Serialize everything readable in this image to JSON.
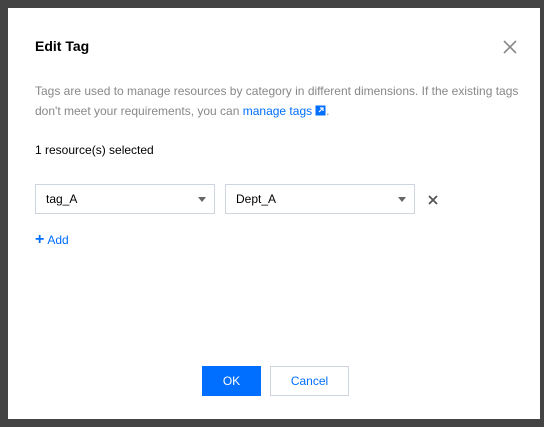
{
  "dialog": {
    "title": "Edit Tag",
    "description_text": "Tags are used to manage resources by category in different dimensions. If the existing tags don't meet your requirements, you can ",
    "manage_tags_link": "manage tags",
    "description_end": ".",
    "selected_count": "1 resource(s) selected",
    "tag_rows": [
      {
        "key": "tag_A",
        "value": "Dept_A"
      }
    ],
    "add_label": "Add",
    "ok_label": "OK",
    "cancel_label": "Cancel"
  },
  "colors": {
    "accent": "#006eff",
    "muted_text": "#888888",
    "border": "#cfd5de",
    "backdrop": "#444444"
  },
  "icons": [
    "close-icon",
    "external-link-icon",
    "chevron-down-icon",
    "remove-icon",
    "plus-icon"
  ]
}
